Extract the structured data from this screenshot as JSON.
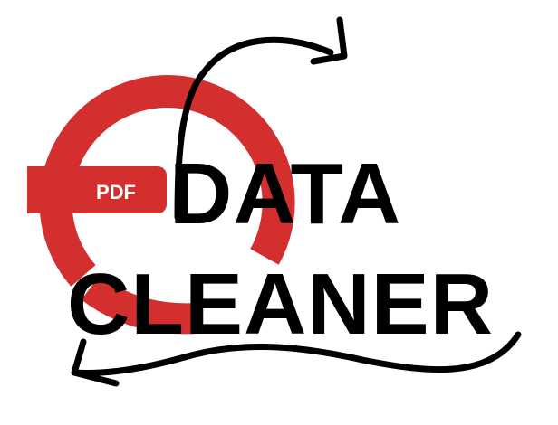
{
  "logo": {
    "badge_text": "PDF",
    "line1": "DATA",
    "line2": "CLEANER"
  },
  "colors": {
    "background": "#ffffff",
    "brand_red": "#d32f2f",
    "ink": "#000000",
    "badge_text": "#ffffff"
  },
  "icons": {
    "arrow_top": "curved-arrow-icon",
    "arrow_bottom": "wavy-arrow-icon",
    "ring": "circular-arrow-ring-icon"
  }
}
